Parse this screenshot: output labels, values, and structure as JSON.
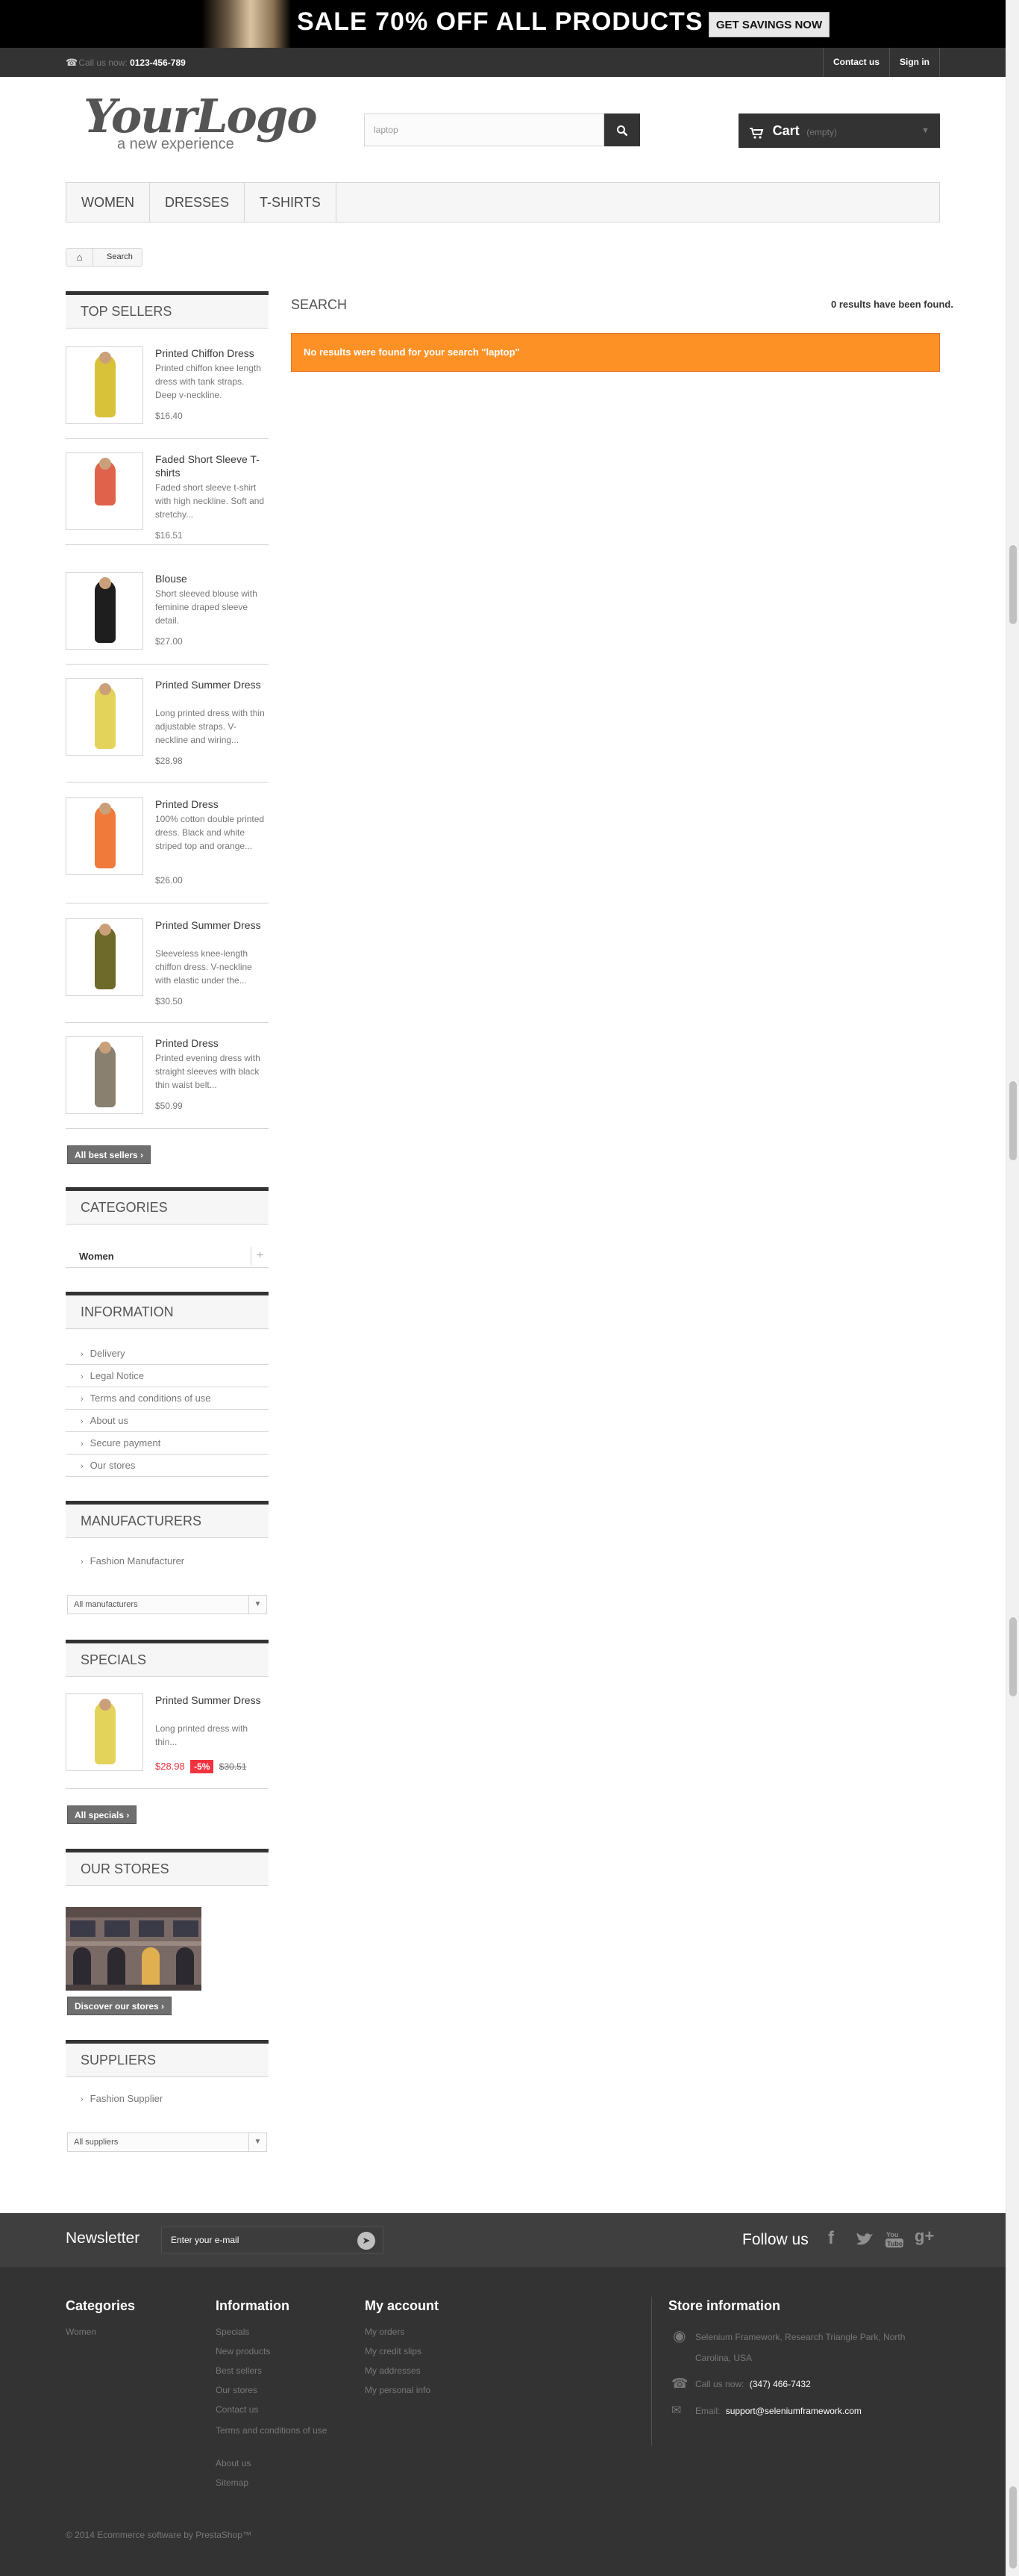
{
  "banner": {
    "text": "SALE 70% OFF ALL PRODUCTS",
    "button": "GET SAVINGS NOW"
  },
  "topnav": {
    "call_label": "Call us now:",
    "phone": "0123-456-789",
    "contact": "Contact us",
    "signin": "Sign in"
  },
  "logo": {
    "main": "YourLogo",
    "tagline": "a new experience"
  },
  "search": {
    "value": "laptop"
  },
  "cart": {
    "label": "Cart",
    "status": "(empty)"
  },
  "menu": [
    "WOMEN",
    "DRESSES",
    "T-SHIRTS"
  ],
  "breadcrumb": {
    "current": "Search"
  },
  "results": {
    "title": "SEARCH",
    "count": "0 results have been found.",
    "alert": "No results were found for your search \"laptop\""
  },
  "top_sellers": {
    "title": "TOP SELLERS",
    "items": [
      {
        "name": "Printed Chiffon Dress",
        "desc": "Printed chiffon knee length dress with tank straps. Deep v-neckline.",
        "price": "$16.40"
      },
      {
        "name": "Faded Short Sleeve T-shirts",
        "desc": "Faded short sleeve t-shirt with high neckline. Soft and stretchy...",
        "price": "$16.51"
      },
      {
        "name": "Blouse",
        "desc": "Short sleeved blouse with feminine draped sleeve detail.",
        "price": "$27.00"
      },
      {
        "name": "Printed Summer Dress",
        "desc": "Long printed dress with thin adjustable straps. V-neckline and wiring...",
        "price": "$28.98"
      },
      {
        "name": "Printed Dress",
        "desc": "100% cotton double printed dress. Black and white striped top and orange...",
        "price": "$26.00"
      },
      {
        "name": "Printed Summer Dress",
        "desc": "Sleeveless knee-length chiffon dress. V-neckline with elastic under the...",
        "price": "$30.50"
      },
      {
        "name": "Printed Dress",
        "desc": "Printed evening dress with straight sleeves with black thin waist belt...",
        "price": "$50.99"
      }
    ],
    "button": "All best sellers"
  },
  "categories": {
    "title": "CATEGORIES",
    "items": [
      "Women"
    ]
  },
  "information": {
    "title": "INFORMATION",
    "items": [
      "Delivery",
      "Legal Notice",
      "Terms and conditions of use",
      "About us",
      "Secure payment",
      "Our stores"
    ]
  },
  "manufacturers": {
    "title": "MANUFACTURERS",
    "items": [
      "Fashion Manufacturer"
    ],
    "select": "All manufacturers"
  },
  "specials": {
    "title": "SPECIALS",
    "name": "Printed Summer Dress",
    "desc": "Long printed dress with thin...",
    "price": "$28.98",
    "discount": "-5%",
    "old_price": "$30.51",
    "button": "All specials"
  },
  "our_stores": {
    "title": "OUR STORES",
    "button": "Discover our stores"
  },
  "suppliers": {
    "title": "SUPPLIERS",
    "items": [
      "Fashion Supplier"
    ],
    "select": "All suppliers"
  },
  "newsletter": {
    "title": "Newsletter",
    "placeholder": "Enter your e-mail",
    "follow": "Follow us"
  },
  "footer": {
    "categories": {
      "title": "Categories",
      "items": [
        "Women"
      ]
    },
    "information": {
      "title": "Information",
      "items": [
        "Specials",
        "New products",
        "Best sellers",
        "Our stores",
        "Contact us",
        "Terms and conditions of use",
        "About us",
        "Sitemap"
      ]
    },
    "account": {
      "title": "My account",
      "items": [
        "My orders",
        "My credit slips",
        "My addresses",
        "My personal info"
      ]
    },
    "store": {
      "title": "Store information",
      "address": "Selenium Framework, Research Triangle Park, North Carolina, USA",
      "call_label": "Call us now:",
      "phone": "(347) 466-7432",
      "email_label": "Email:",
      "email": "support@seleniumframework.com"
    },
    "copyright": "© 2014 Ecommerce software by PrestaShop™"
  },
  "colors": {
    "accent_orange": "#fe9126",
    "dark": "#333333",
    "special_red": "#f13340"
  }
}
